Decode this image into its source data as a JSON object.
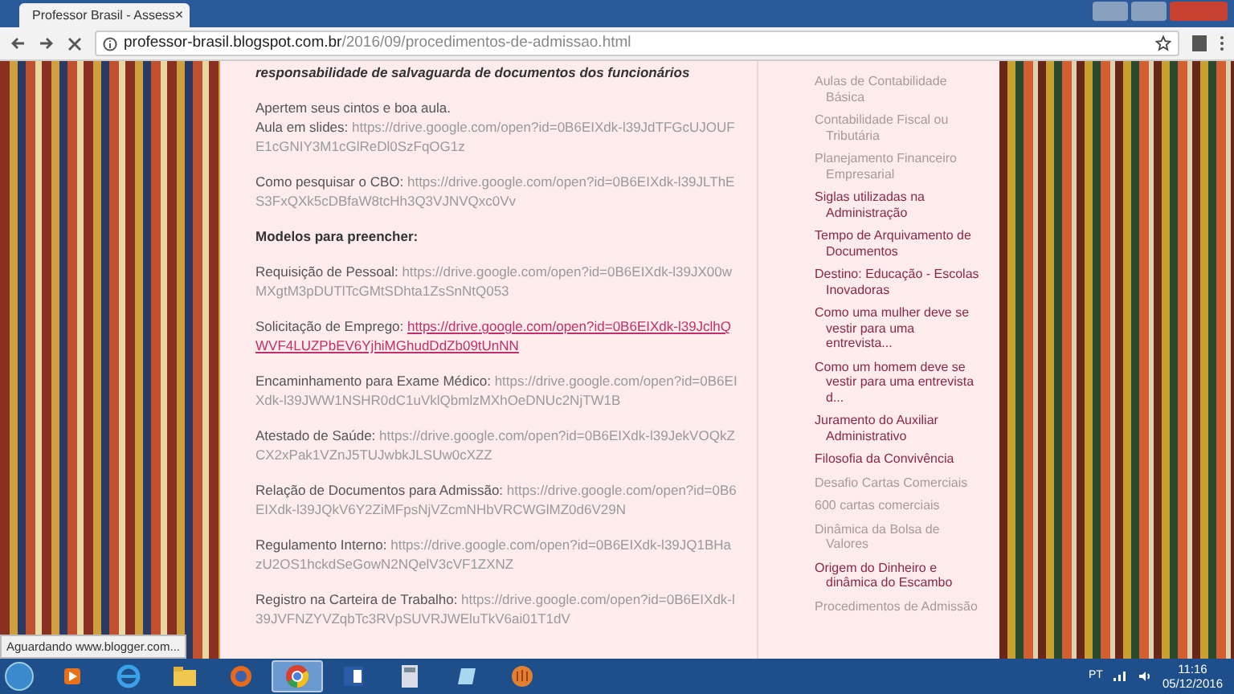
{
  "browser": {
    "tab": {
      "title": "Professor Brasil - Assess",
      "close": "×"
    },
    "address": {
      "host": "professor-brasil.blogspot.com.br",
      "path": "/2016/09/procedimentos-de-admissao.html"
    }
  },
  "post": {
    "paragraphs": [
      {
        "kind": "heading",
        "text": "responsabilidade de salvaguarda de documentos dos funcionários"
      },
      {
        "kind": "lines",
        "lines": [
          {
            "label": "Apertem seus cintos e boa aula."
          },
          {
            "label": "Aula em slides:",
            "url": "https://drive.google.com/open?id=0B6EIXdk-l39JdTFGcUJOUFE1cGNIY3M1cGlReDl0SzFqOG1z",
            "hovered": false
          }
        ]
      },
      {
        "kind": "lines",
        "lines": [
          {
            "label": "Como pesquisar o CBO:",
            "url": "https://drive.google.com/open?id=0B6EIXdk-l39JLThES3FxQXk5cDBfaW8tcHh3Q3VJNVQxc0Vv",
            "hovered": false
          }
        ]
      },
      {
        "kind": "subheading",
        "text": "Modelos para preencher:"
      },
      {
        "kind": "lines",
        "lines": [
          {
            "label": "Requisição de Pessoal:",
            "url": "https://drive.google.com/open?id=0B6EIXdk-l39JX00wMXgtM3pDUTlTcGMtSDhta1ZsSnNtQ053",
            "hovered": false
          }
        ]
      },
      {
        "kind": "lines",
        "lines": [
          {
            "label": "Solicitação de Emprego:",
            "url": "https://drive.google.com/open?id=0B6EIXdk-l39JclhQWVF4LUZPbEV6YjhiMGhudDdZb09tUnNN",
            "hovered": true
          }
        ]
      },
      {
        "kind": "lines",
        "lines": [
          {
            "label": "Encaminhamento para Exame Médico:",
            "url": "https://drive.google.com/open?id=0B6EIXdk-l39JWW1NSHR0dC1uVklQbmlzMXhOeDNUc2NjTW1B",
            "hovered": false
          }
        ]
      },
      {
        "kind": "lines",
        "lines": [
          {
            "label": "Atestado de Saúde:",
            "url": "https://drive.google.com/open?id=0B6EIXdk-l39JekVOQkZCX2xPak1VZnJ5TUJwbkJLSUw0cXZZ",
            "hovered": false
          }
        ]
      },
      {
        "kind": "lines",
        "lines": [
          {
            "label": "Relação de Documentos para Admissão:",
            "url": "https://drive.google.com/open?id=0B6EIXdk-l39JQkV6Y2ZiMFpsNjVZcmNHbVRCWGlMZ0d6V29N",
            "hovered": false
          }
        ]
      },
      {
        "kind": "lines",
        "lines": [
          {
            "label": "Regulamento Interno:",
            "url": "https://drive.google.com/open?id=0B6EIXdk-l39JQ1BHazU2OS1hckdSeGowN2NQelV3cVF1ZXNZ",
            "hovered": false
          }
        ]
      },
      {
        "kind": "lines",
        "lines": [
          {
            "label": "Registro na Carteira de Trabalho:",
            "url": "https://drive.google.com/open?id=0B6EIXdk-l39JVFNZYVZqbTc3RVpSUVRJWEluTkV6ai01T1dV",
            "hovered": false
          }
        ]
      }
    ]
  },
  "sidebar": {
    "items": [
      {
        "text": "Aulas de Contabilidade Básica",
        "visited": true
      },
      {
        "text": "Contabilidade Fiscal ou Tributária",
        "visited": true
      },
      {
        "text": "Planejamento Financeiro Empresarial",
        "visited": true
      },
      {
        "text": "Siglas utilizadas na Administração",
        "visited": false
      },
      {
        "text": "Tempo de Arquivamento de Documentos",
        "visited": false
      },
      {
        "text": "Destino: Educação - Escolas Inovadoras",
        "visited": false
      },
      {
        "text": "Como uma mulher deve se vestir para uma entrevista...",
        "visited": false
      },
      {
        "text": "Como um homem deve se vestir para uma entrevista d...",
        "visited": false
      },
      {
        "text": "Juramento do Auxiliar Administrativo",
        "visited": false
      },
      {
        "text": "Filosofia da Convivência",
        "visited": false
      },
      {
        "text": "Desafio Cartas Comerciais",
        "visited": true
      },
      {
        "text": "600 cartas comerciais",
        "visited": true
      },
      {
        "text": "Dinâmica da Bolsa de Valores",
        "visited": true
      },
      {
        "text": "Origem do Dinheiro e dinâmica do Escambo",
        "visited": false
      },
      {
        "text": "Procedimentos de Admissão",
        "visited": true
      }
    ]
  },
  "status_bubble": "Aguardando www.blogger.com...",
  "taskbar": {
    "apps": [
      {
        "kind": "media",
        "active": false
      },
      {
        "kind": "ie",
        "active": false
      },
      {
        "kind": "folder",
        "active": false
      },
      {
        "kind": "firefox",
        "active": false
      },
      {
        "kind": "chrome",
        "active": true
      },
      {
        "kind": "word",
        "active": false
      },
      {
        "kind": "calc",
        "active": false
      },
      {
        "kind": "notes",
        "active": false
      },
      {
        "kind": "mitt",
        "active": false
      }
    ],
    "language": "PT",
    "time": "11:16",
    "date": "05/12/2016"
  }
}
